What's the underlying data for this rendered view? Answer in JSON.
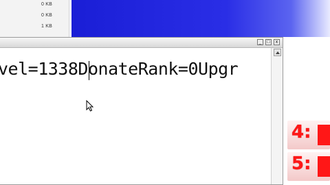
{
  "background": {
    "file_sizes": [
      "0 KB",
      "0 KB",
      "1 KB"
    ],
    "rank_rows": [
      {
        "label": "4:"
      },
      {
        "label": "5:"
      }
    ]
  },
  "window": {
    "title_buttons": [
      "_",
      "□",
      "x"
    ],
    "text": "vel=1338DonateRank=0Upgr"
  },
  "colors": {
    "blue_bg": "#2a2ee6",
    "rank_red": "#ff1717"
  }
}
